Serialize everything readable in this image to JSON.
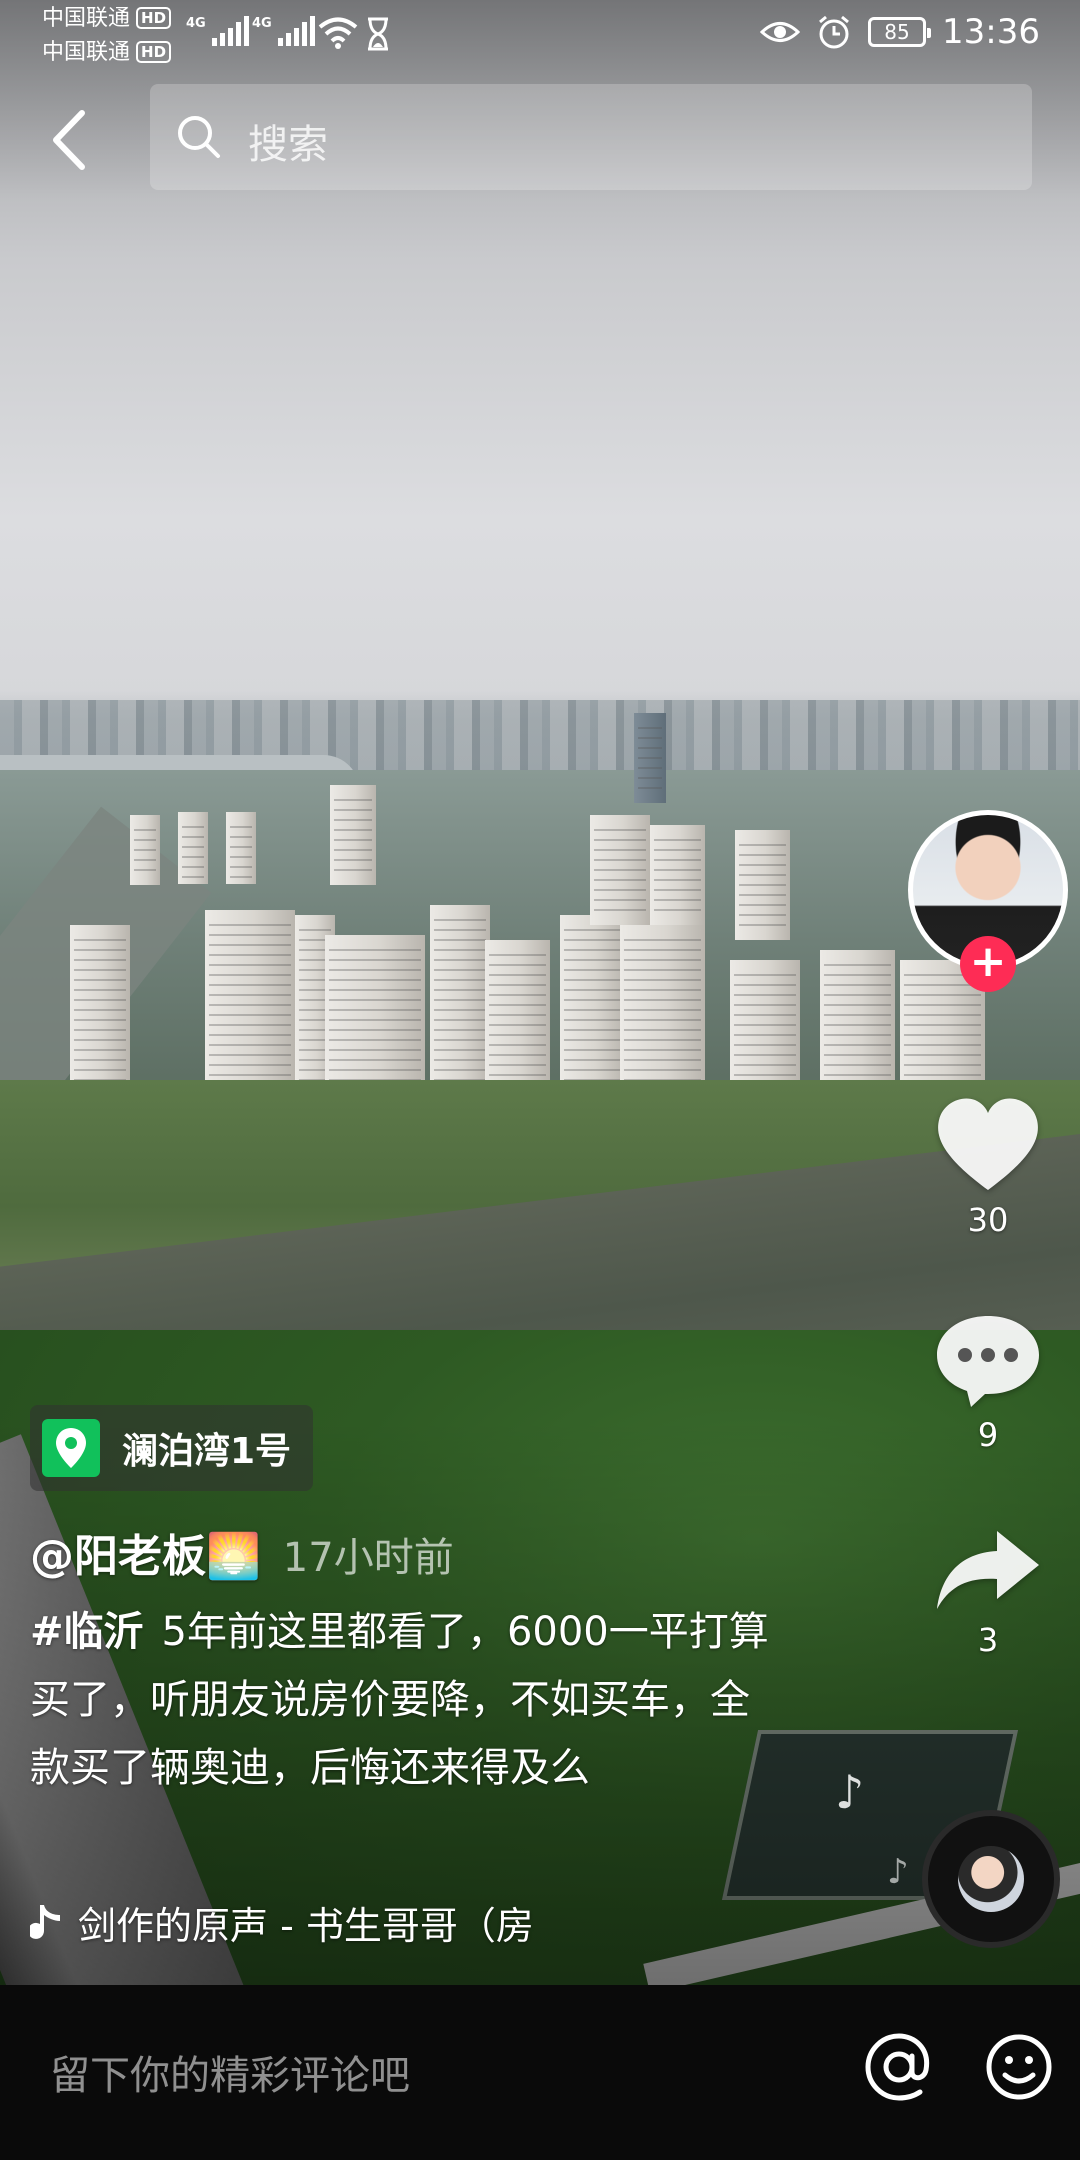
{
  "status_bar": {
    "carrier1": "中国联通",
    "carrier2": "中国联通",
    "hd_badge": "HD",
    "network1": "4G",
    "network2": "4G",
    "battery": "85",
    "time": "13:36"
  },
  "header": {
    "search_placeholder": "搜索"
  },
  "creator": {
    "follow_symbol": "+"
  },
  "actions": {
    "likes": "30",
    "comments": "9",
    "shares": "3"
  },
  "location": {
    "label": "澜泊湾1号"
  },
  "post": {
    "author": "@阳老板🌅",
    "time_ago": "17小时前",
    "hashtag": "#临沂",
    "text": "5年前这里都看了，6000一平打算买了，听朋友说房价要降，不如买车，全款买了辆奥迪，后悔还来得及么"
  },
  "music": {
    "title": "剑作的原声 - 书生哥哥（房"
  },
  "comment_bar": {
    "placeholder": "留下你的精彩评论吧"
  },
  "colors": {
    "follow_red": "#fe2c55",
    "location_green": "#11c15b"
  },
  "icons": [
    "back-arrow-icon",
    "search-icon",
    "heart-icon",
    "comment-bubble-icon",
    "share-arrow-icon",
    "location-pin-icon",
    "music-note-icon",
    "at-icon",
    "emoji-icon",
    "eye-icon",
    "alarm-icon",
    "wifi-icon",
    "hourglass-icon"
  ]
}
